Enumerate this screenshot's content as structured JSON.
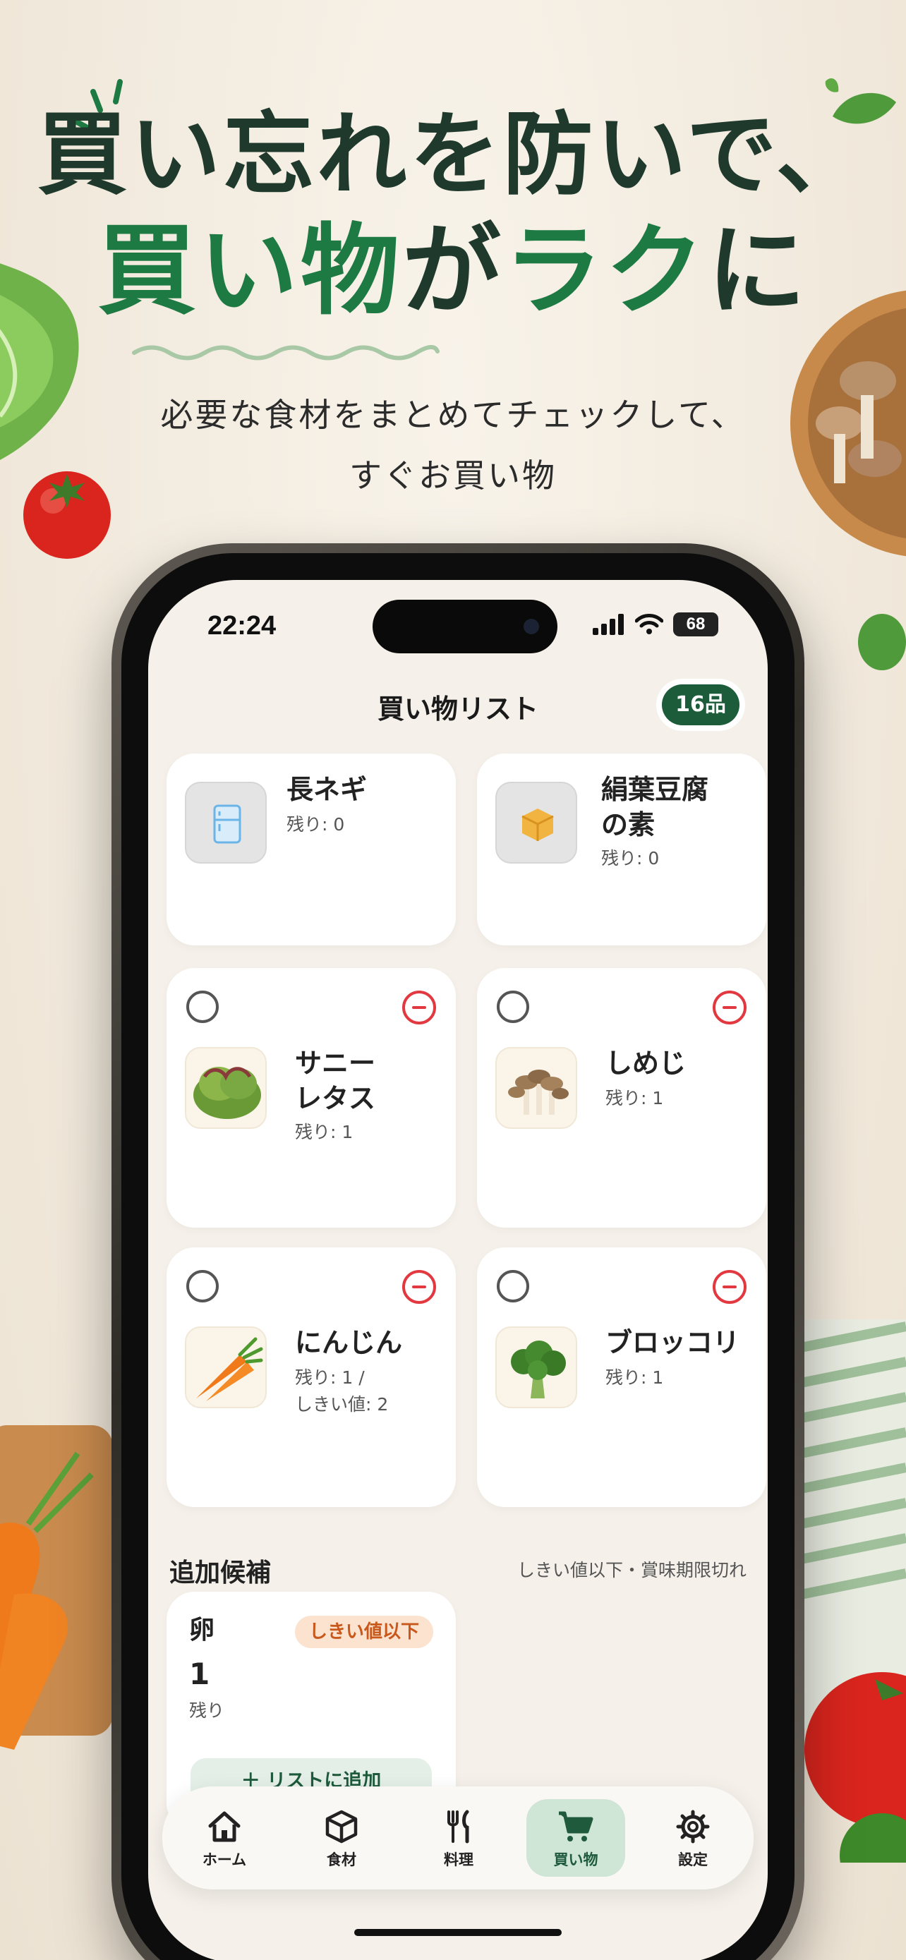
{
  "headline": {
    "line1": "買い忘れを防いで、",
    "line2_part1": "買い物",
    "line2_part2": "が",
    "line2_part3": "ラク",
    "line2_part4": "に"
  },
  "subtitle": {
    "line1": "必要な食材をまとめてチェックして、",
    "line2": "すぐお買い物"
  },
  "status_bar": {
    "time": "22:24",
    "battery": "68"
  },
  "nav": {
    "title": "買い物リスト",
    "count_badge": "16品"
  },
  "top_cards": [
    {
      "name": "長ネギ",
      "sub": "残り: 0",
      "icon": "fridge-icon"
    },
    {
      "name_line1": "絹葉豆腐",
      "name_line2": "の素",
      "sub": "残り: 0",
      "icon": "box-icon"
    }
  ],
  "items": [
    {
      "name_line1": "サニー",
      "name_line2": "レタス",
      "sub": "残り: 1",
      "image": "lettuce"
    },
    {
      "name_line1": "しめじ",
      "sub": "残り: 1",
      "image": "shimeji"
    },
    {
      "name_line1": "にんじん",
      "sub_line1": "残り: 1 /",
      "sub_line2": "しきい値: 2",
      "image": "carrot"
    },
    {
      "name_line1": "ブロッコリ",
      "sub": "残り: 1",
      "image": "broccoli"
    }
  ],
  "suggestions": {
    "title": "追加候補",
    "note": "しきい値以下・賞味期限切れ",
    "card": {
      "name": "卵",
      "badge": "しきい値以下",
      "quantity": "1",
      "quantity_label": "残り",
      "add_button": "リストに追加"
    }
  },
  "tabbar": {
    "items": [
      {
        "label": "ホーム",
        "icon": "home-icon"
      },
      {
        "label": "食材",
        "icon": "cube-icon"
      },
      {
        "label": "料理",
        "icon": "utensils-icon"
      },
      {
        "label": "買い物",
        "icon": "cart-icon",
        "active": true
      },
      {
        "label": "設定",
        "icon": "gear-icon"
      }
    ]
  },
  "colors": {
    "brand_green": "#1e7a43",
    "dark_green": "#1d5c3b",
    "danger_red": "#e2383f",
    "threshold_orange": "#c8581c",
    "background": "#f3ece1"
  }
}
